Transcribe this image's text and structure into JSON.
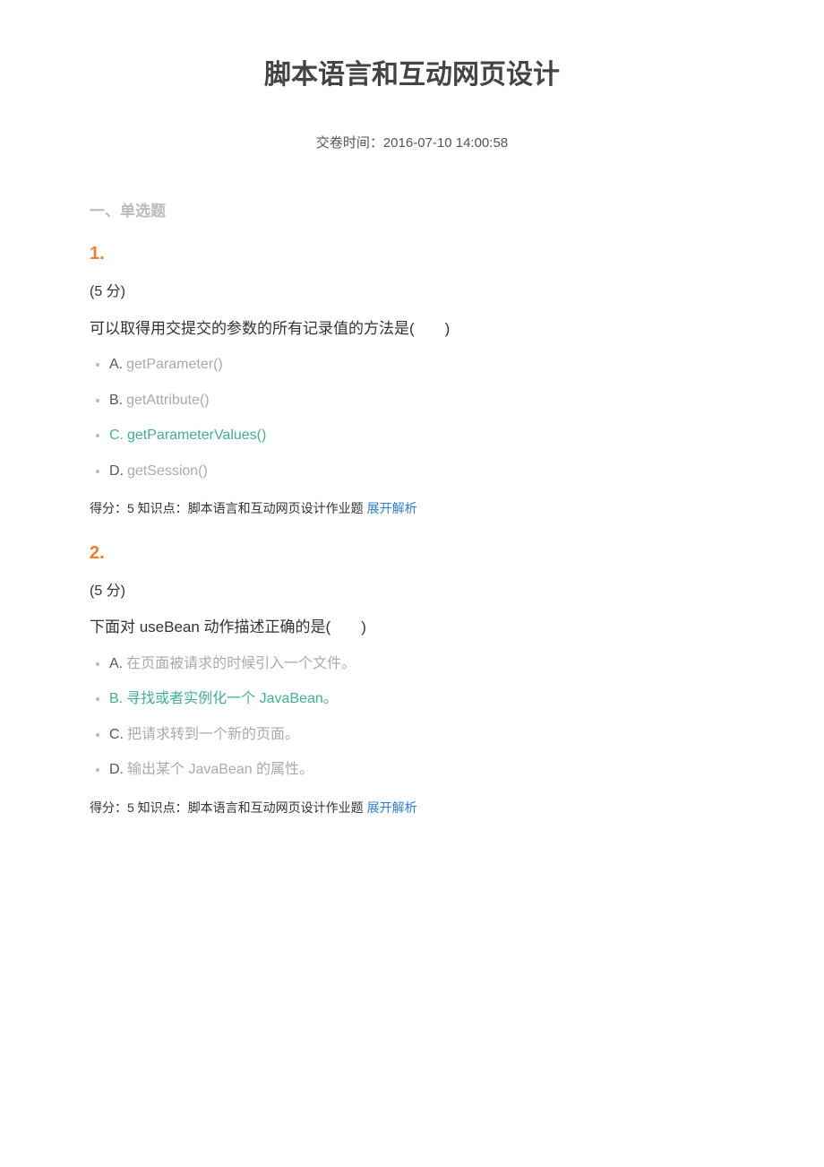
{
  "title": "脚本语言和互动网页设计",
  "subtitle": "交卷时间：2016-07-10 14:00:58",
  "section_heading": "一、单选题",
  "expand_label": "展开解析",
  "score_prefix": "得分：",
  "kp_prefix": " 知识点：",
  "kp_text": "脚本语言和互动网页设计作业题",
  "questions": [
    {
      "num": "1.",
      "points": "(5 分)",
      "stem": "可以取得用交提交的参数的所有记录值的方法是(　　)",
      "score": "5",
      "options": [
        {
          "label": "A.",
          "text": "getParameter()",
          "correct": false
        },
        {
          "label": "B.",
          "text": "getAttribute()",
          "correct": false
        },
        {
          "label": "C.",
          "text": "getParameterValues()",
          "correct": true
        },
        {
          "label": "D.",
          "text": "getSession()",
          "correct": false
        }
      ]
    },
    {
      "num": "2.",
      "points": "(5 分)",
      "stem": "下面对 useBean 动作描述正确的是(　　)",
      "score": "5",
      "options": [
        {
          "label": "A.",
          "text": "在页面被请求的时候引入一个文件。",
          "correct": false
        },
        {
          "label": "B.",
          "text": "寻找或者实例化一个 JavaBean。",
          "correct": true
        },
        {
          "label": "C.",
          "text": "把请求转到一个新的页面。",
          "correct": false
        },
        {
          "label": "D.",
          "text": "输出某个 JavaBean 的属性。",
          "correct": false
        }
      ]
    }
  ]
}
